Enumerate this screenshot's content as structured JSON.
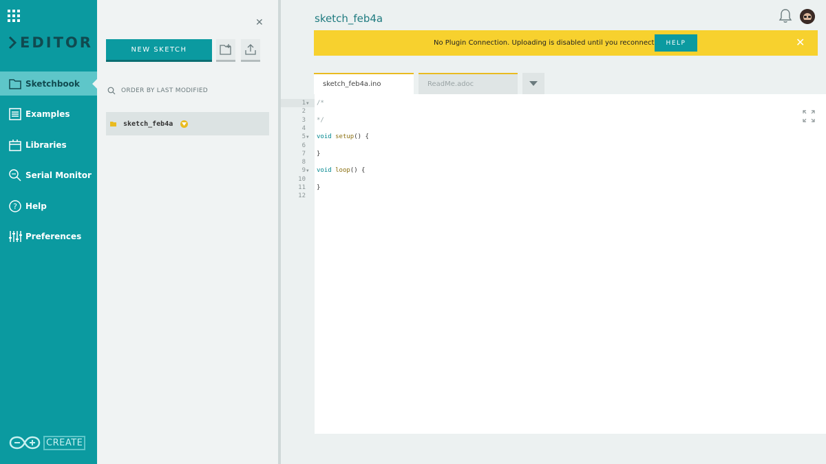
{
  "app": {
    "name": "EDITOR",
    "logo_text": "CREATE"
  },
  "nav": {
    "items": [
      {
        "label": "Sketchbook",
        "icon": "folder-icon",
        "active": true
      },
      {
        "label": "Examples",
        "icon": "list-icon"
      },
      {
        "label": "Libraries",
        "icon": "library-icon"
      },
      {
        "label": "Serial Monitor",
        "icon": "magnifier-icon"
      },
      {
        "label": "Help",
        "icon": "help-icon"
      },
      {
        "label": "Preferences",
        "icon": "sliders-icon"
      }
    ]
  },
  "sketchbook": {
    "new_sketch_label": "NEW SKETCH",
    "order_label": "ORDER BY LAST MODIFIED",
    "sketches": [
      {
        "name": "sketch_feb4a"
      }
    ]
  },
  "main": {
    "title": "sketch_feb4a",
    "banner": {
      "text": "No Plugin Connection. Uploading is disabled until you reconnect.",
      "help_label": "HELP"
    },
    "tabs": [
      {
        "label": "sketch_feb4a.ino",
        "active": true
      },
      {
        "label": "ReadMe.adoc",
        "active": false
      }
    ],
    "code_lines": [
      {
        "n": "1",
        "text": "/*",
        "fold": true
      },
      {
        "n": "2",
        "text": ""
      },
      {
        "n": "3",
        "text": "*/"
      },
      {
        "n": "4",
        "text": ""
      },
      {
        "n": "5",
        "text": "void setup() {",
        "fold": true
      },
      {
        "n": "6",
        "text": ""
      },
      {
        "n": "7",
        "text": "}"
      },
      {
        "n": "8",
        "text": ""
      },
      {
        "n": "9",
        "text": "void loop() {",
        "fold": true
      },
      {
        "n": "10",
        "text": ""
      },
      {
        "n": "11",
        "text": "}"
      },
      {
        "n": "12",
        "text": ""
      }
    ]
  },
  "colors": {
    "accent": "#0b9aa0",
    "banner": "#f7d12e",
    "tab_indicator": "#e9bb20"
  }
}
